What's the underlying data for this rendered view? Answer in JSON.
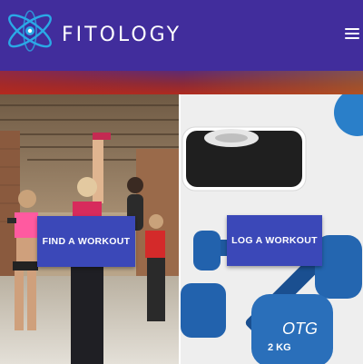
{
  "header": {
    "brand": "FITOLOGY",
    "logo_icon": "atom-orbit-logo-icon",
    "menu_icon": "hamburger-menu-icon",
    "background": "#412d9c"
  },
  "panels": {
    "find": {
      "button_label": "FIND A WORKOUT",
      "image": "women-lifting-dumbbells-photo"
    },
    "log": {
      "button_label": "LOG A WORKOUT",
      "image": "dumbbells-and-scale-photo",
      "dumbbell_brand": "OTG",
      "dumbbell_weight": "2 KG"
    }
  },
  "colors": {
    "accent": "#3b48b8",
    "logo_blue": "#2aa9e6"
  }
}
